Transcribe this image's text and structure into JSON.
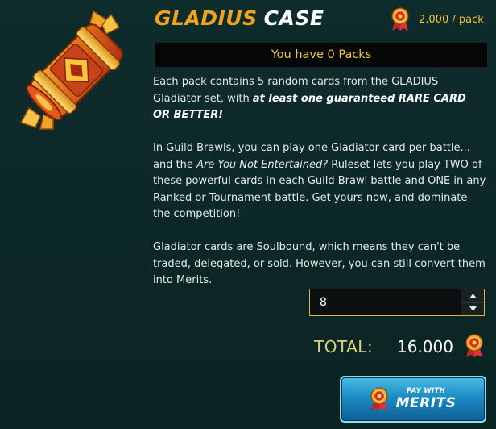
{
  "header": {
    "title_part1": "GLADIUS",
    "title_part2": "CASE",
    "price_label": "2.000 / pack"
  },
  "banner": {
    "text": "You have 0 Packs"
  },
  "description": {
    "p1_text": "Each pack contains 5 random cards from the GLADIUS Gladiator set, with ",
    "p1_emph": "at least one guaranteed RARE CARD OR BETTER!",
    "p2_text1": "In Guild Brawls, you can play one Gladiator card per battle... and the ",
    "p2_emph": "Are You Not Entertained?",
    "p2_text2": " Ruleset lets you play TWO of these powerful cards in each Guild Brawl battle and ONE in any Ranked or Tournament battle. Get yours now, and dominate the competition!",
    "p3_text": "Gladiator cards are Soulbound, which means they can't be traded, delegated, or sold. However, you can still convert them into Merits."
  },
  "quantity": {
    "value": "8"
  },
  "total": {
    "label": "TOTAL:",
    "value": "16.000"
  },
  "pay_button": {
    "line1": "PAY WITH",
    "line2": "MERITS"
  },
  "colors": {
    "title_orange": "#f0a31c",
    "gold": "#f3c22e",
    "button_blue": "#1a8cc4",
    "background": "#0f2c2c"
  },
  "icons": [
    "gladius-case-icon",
    "merit-coin-icon",
    "chevron-up-icon",
    "chevron-down-icon"
  ]
}
